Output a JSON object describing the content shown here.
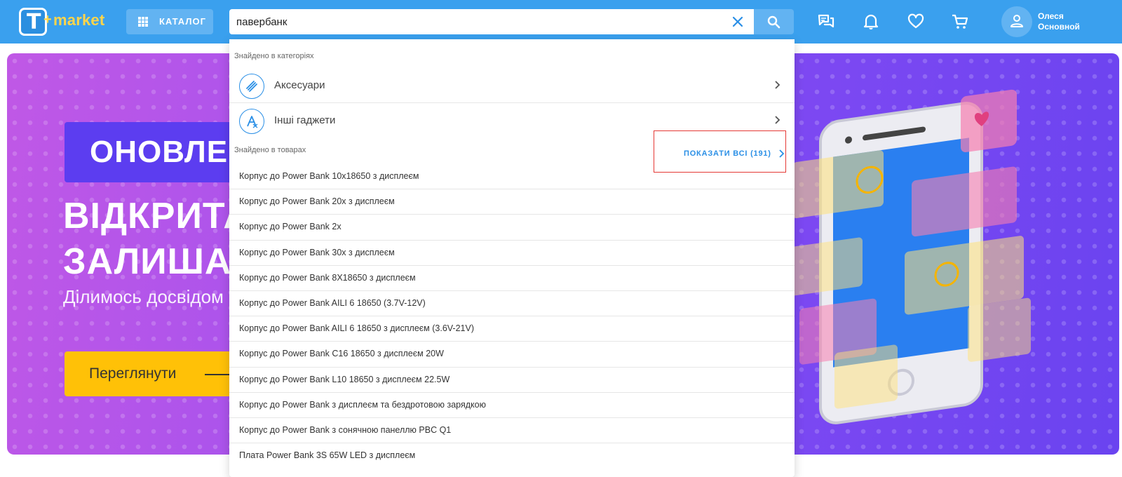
{
  "header": {
    "logo": {
      "letter": "T",
      "plus": "+",
      "text": "market"
    },
    "catalog_label": "КАТАЛОГ",
    "search": {
      "value": "павербанк"
    },
    "user": {
      "first_name": "Олеся",
      "last_name": "Основной"
    },
    "icons": [
      "chat-icon",
      "bell-icon",
      "heart-icon",
      "cart-icon",
      "user-icon"
    ]
  },
  "banner": {
    "tag": "ОНОВЛЕН",
    "line1": "ВІДКРИТА",
    "line2": "ЗАЛИША",
    "subtitle": "Ділимось досвідом",
    "cta": "Переглянути"
  },
  "dropdown": {
    "categories_label": "Знайдено в категоріях",
    "categories": [
      {
        "label": "Аксесуари",
        "icon": "accessories-icon"
      },
      {
        "label": "Інші гаджети",
        "icon": "gadgets-icon"
      }
    ],
    "products_label": "Знайдено в товарах",
    "show_all": "ПОКАЗАТИ ВСІ (191)",
    "products": [
      "Корпус до Power Bank 10x18650 з дисплеєм",
      "Корпус до Power Bank 20x з дисплеєм",
      "Корпус до Power Bank 2x",
      "Корпус до Power Bank 30x з дисплеєм",
      "Корпус до Power Bank 8X18650 з дисплеєм",
      "Корпус до Power Bank AILI 6 18650 (3.7V-12V)",
      "Корпус до Power Bank AILI 6 18650 з дисплеєм (3.6V-21V)",
      "Корпус до Power Bank C16 18650 з дисплеєм 20W",
      "Корпус до Power Bank L10 18650 з дисплеєм 22.5W",
      "Корпус до Power Bank з дисплеєм та бездротовою зарядкою",
      "Корпус до Power Bank з сонячною панеллю PBC Q1",
      "Плата Power Bank 3S 65W LED з дисплеєм"
    ]
  },
  "colors": {
    "header": "#3aa0ee",
    "accent": "#2a8fe6",
    "highlight": "#e53935",
    "cta": "#ffc107"
  }
}
